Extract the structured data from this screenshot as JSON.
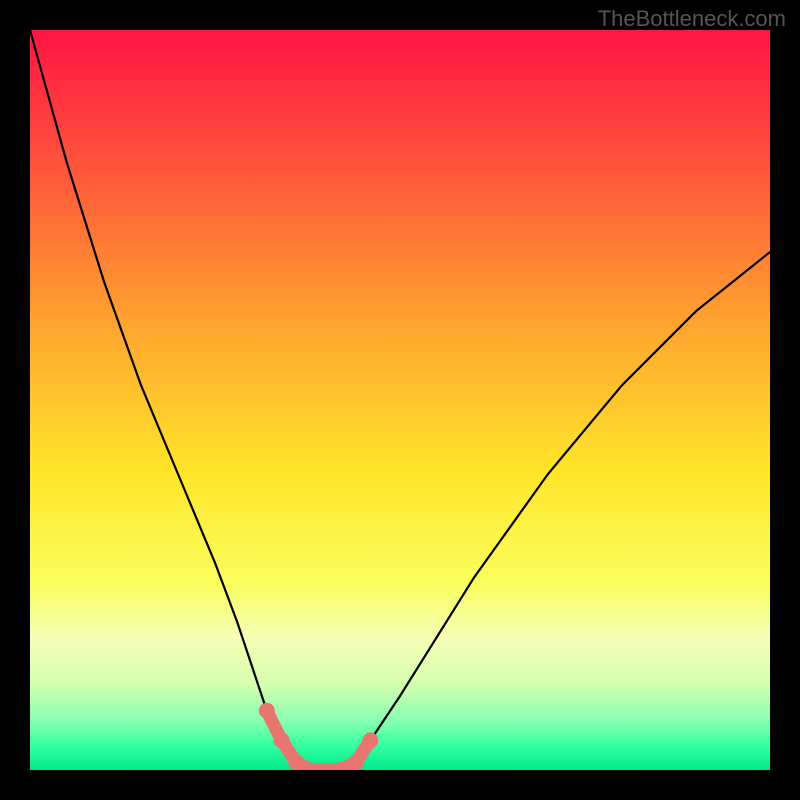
{
  "watermark": "TheBottleneck.com",
  "chart_data": {
    "type": "line",
    "title": "",
    "xlabel": "",
    "ylabel": "",
    "xlim": [
      0,
      100
    ],
    "ylim": [
      0,
      100
    ],
    "grid": false,
    "series": [
      {
        "name": "bottleneck-curve",
        "x": [
          0,
          5,
          10,
          15,
          20,
          25,
          28,
          30,
          32,
          34,
          36,
          38,
          40,
          42,
          44,
          46,
          50,
          55,
          60,
          65,
          70,
          75,
          80,
          85,
          90,
          95,
          100
        ],
        "y": [
          100,
          82,
          66,
          52,
          40,
          28,
          20,
          14,
          8,
          4,
          1,
          0,
          0,
          0,
          1,
          4,
          10,
          18,
          26,
          33,
          40,
          46,
          52,
          57,
          62,
          66,
          70
        ]
      }
    ],
    "highlight": {
      "name": "optimal-zone",
      "color": "#e8766e",
      "x": [
        32,
        34,
        36,
        38,
        40,
        42,
        44,
        46
      ],
      "y": [
        8,
        4,
        1,
        0,
        0,
        0,
        1,
        4
      ]
    },
    "background_gradient": {
      "stops": [
        {
          "offset": 0,
          "color": "#ff1444"
        },
        {
          "offset": 20,
          "color": "#ff5a3a"
        },
        {
          "offset": 40,
          "color": "#ffa52f"
        },
        {
          "offset": 60,
          "color": "#ffe62a"
        },
        {
          "offset": 75,
          "color": "#faff5f"
        },
        {
          "offset": 82,
          "color": "#f5ffb5"
        },
        {
          "offset": 88,
          "color": "#d8ffaf"
        },
        {
          "offset": 93,
          "color": "#8effb0"
        },
        {
          "offset": 97,
          "color": "#2fff9f"
        },
        {
          "offset": 100,
          "color": "#00e88a"
        }
      ]
    }
  }
}
